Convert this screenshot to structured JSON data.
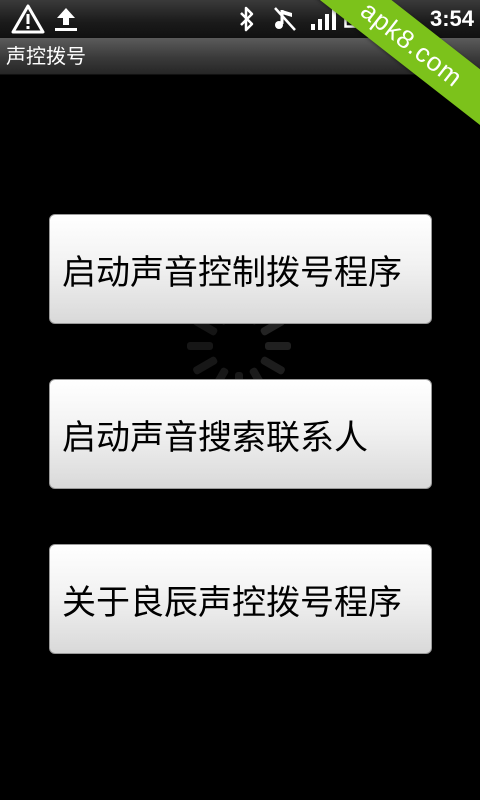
{
  "status_bar": {
    "time": "3:54",
    "icons": [
      "warning-icon",
      "upload-icon",
      "bluetooth-icon",
      "vibrate-mute-icon",
      "signal-icon",
      "battery-icon"
    ]
  },
  "title_bar": {
    "title": "声控拨号"
  },
  "buttons": [
    {
      "label": "启动声音控制拨号程序"
    },
    {
      "label": "启动声音搜索联系人"
    },
    {
      "label": "关于良辰声控拨号程序"
    }
  ],
  "watermark": {
    "text": "apk8.com",
    "color": "#7cc21b"
  }
}
